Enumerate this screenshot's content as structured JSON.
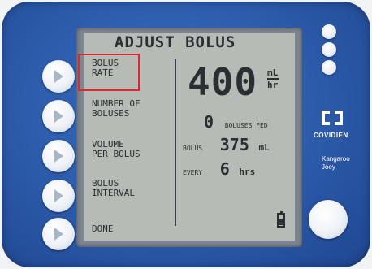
{
  "screen": {
    "title": "ADJUST BOLUS",
    "menu": [
      {
        "line1": "BOLUS",
        "line2": "RATE"
      },
      {
        "line1": "NUMBER OF",
        "line2": "BOLUSES"
      },
      {
        "line1": "VOLUME",
        "line2": "PER BOLUS"
      },
      {
        "line1": "BOLUS",
        "line2": "INTERVAL"
      },
      {
        "line1": "DONE",
        "line2": ""
      }
    ],
    "rate_value": "400",
    "rate_unit_top": "mL",
    "rate_unit_bottom": "hr",
    "boluses_fed_value": "0",
    "boluses_fed_label": "BOLUSES FED",
    "bolus_label": "BOLUS",
    "bolus_value": "375",
    "bolus_unit": "mL",
    "every_label": "EVERY",
    "every_value": "6",
    "every_unit": "hrs",
    "battery_level": 0.6
  },
  "brand": {
    "name": "COVIDIEN",
    "model_line1": "Kangaroo",
    "model_line2": "Joey"
  },
  "icons": [
    "play-triangle-icon",
    "covidien-logo-icon",
    "battery-icon",
    "indicator-dot"
  ],
  "colors": {
    "device_blue": "#2b5aa9",
    "lcd_background": "#b7bbb6",
    "highlight_red": "#e2262a"
  }
}
